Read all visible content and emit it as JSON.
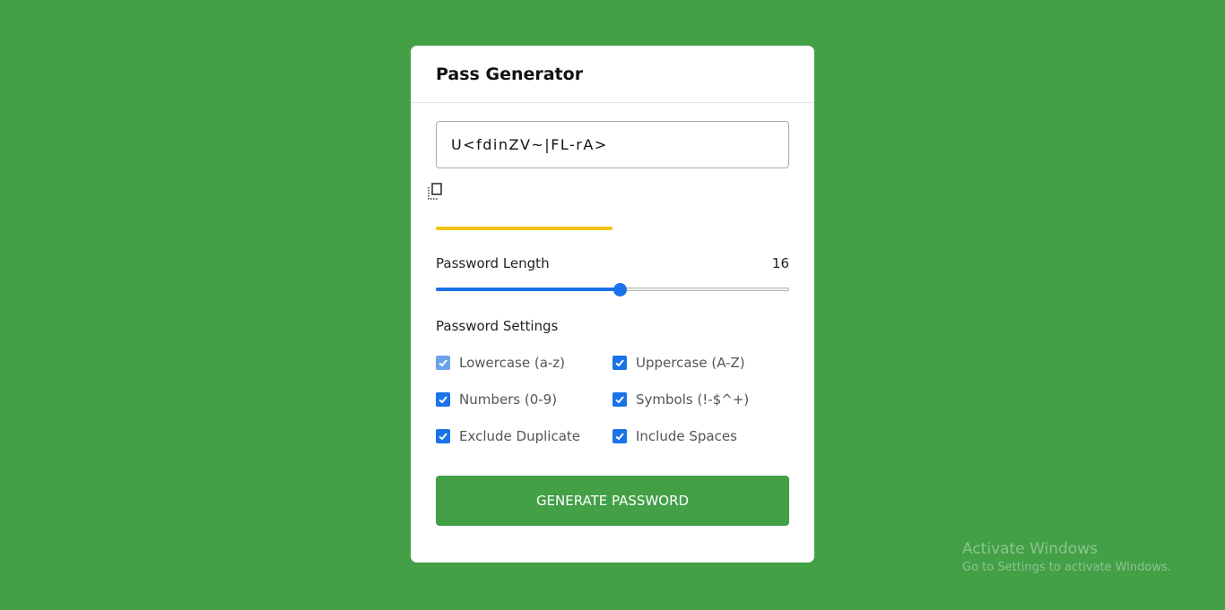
{
  "app": {
    "title": "Pass Generator"
  },
  "password": {
    "value": "U<fdinZV~|FL-rA>"
  },
  "copy": {
    "icon": "copy-icon"
  },
  "strength": {
    "level_fraction": 0.5,
    "color": "#f4c20d"
  },
  "length": {
    "label": "Password Length",
    "value": "16",
    "slider_fraction": 0.52
  },
  "settings": {
    "title": "Password Settings",
    "options": [
      {
        "label": "Lowercase (a-z)",
        "checked": true,
        "disabled": true
      },
      {
        "label": "Uppercase (A-Z)",
        "checked": true,
        "disabled": false
      },
      {
        "label": "Numbers (0-9)",
        "checked": true,
        "disabled": false
      },
      {
        "label": "Symbols (!-$^+)",
        "checked": true,
        "disabled": false
      },
      {
        "label": "Exclude Duplicate",
        "checked": true,
        "disabled": false
      },
      {
        "label": "Include Spaces",
        "checked": true,
        "disabled": false
      }
    ]
  },
  "generate_button": {
    "label": "GENERATE PASSWORD"
  },
  "colors": {
    "background": "#43a047",
    "accent": "#1a73e8",
    "button": "#43a047"
  },
  "watermark": {
    "title": "Activate Windows",
    "subtitle": "Go to Settings to activate Windows."
  }
}
